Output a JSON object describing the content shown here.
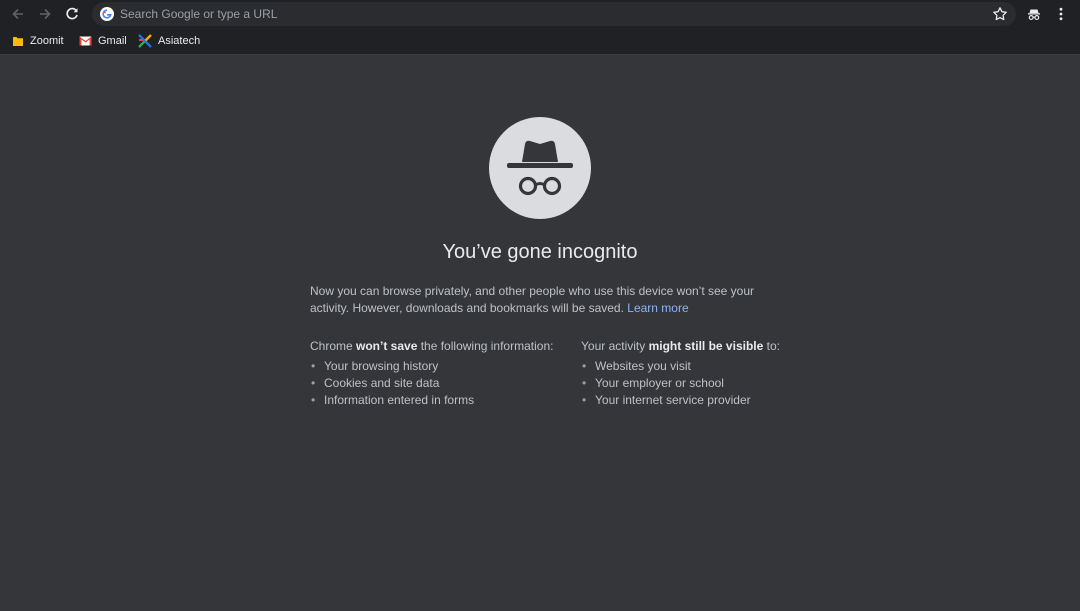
{
  "toolbar": {
    "search_placeholder": "Search Google or type a URL",
    "icons": {
      "back": "arrow-left-icon",
      "forward": "arrow-right-icon",
      "reload": "reload-icon",
      "search_engine": "google-g-icon",
      "bookmark": "star-icon",
      "incognito": "incognito-icon",
      "menu": "kebab-menu-icon"
    }
  },
  "bookmarks": [
    {
      "label": "Zoomit",
      "icon": "folder-icon"
    },
    {
      "label": "Gmail",
      "icon": "gmail-icon"
    },
    {
      "label": "Asiatech",
      "icon": "asiatech-icon"
    }
  ],
  "page": {
    "title": "You’ve gone incognito",
    "intro": "Now you can browse privately, and other people who use this device won’t see your activity. However, downloads and bookmarks will be saved.",
    "learn_more": "Learn more",
    "left": {
      "prefix": "Chrome ",
      "strong": "won’t save",
      "suffix": " the following information:",
      "items": [
        "Your browsing history",
        "Cookies and site data",
        "Information entered in forms"
      ]
    },
    "right": {
      "prefix": "Your activity ",
      "strong": "might still be visible",
      "suffix": " to:",
      "items": [
        "Websites you visit",
        "Your employer or school",
        "Your internet service provider"
      ]
    }
  },
  "colors": {
    "background": "#35363a",
    "toolbar": "#202124",
    "link": "#8ab4f8",
    "hero_circle": "#dadce0"
  }
}
